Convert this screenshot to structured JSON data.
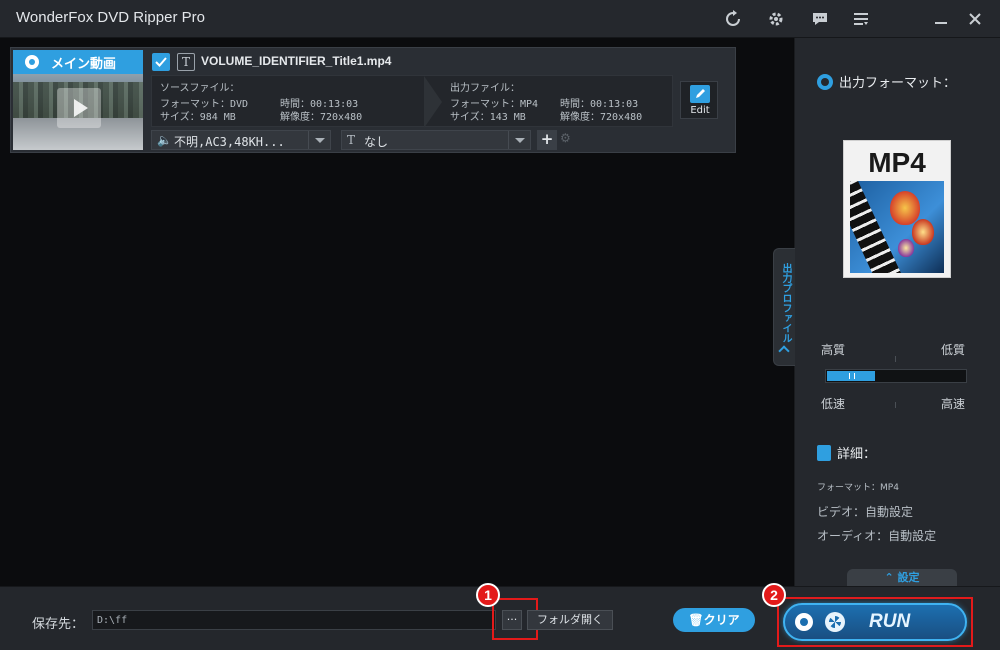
{
  "app": {
    "title": "WonderFox DVD Ripper Pro"
  },
  "titlebar_icons": [
    "refresh-icon",
    "settings-icon",
    "feedback-icon",
    "menu-icon",
    "minimize-icon",
    "close-icon"
  ],
  "item": {
    "thumb_label": "メイン動画",
    "checked": true,
    "file_name": "VOLUME_IDENTIFIER_Title1.mp4",
    "source": {
      "header": "ソースファイル：",
      "format": "フォーマット：DVD",
      "size": "サイズ：984 MB",
      "duration": "時間：00:13:03",
      "resolution": "解像度：720x480"
    },
    "output": {
      "header": "出力ファイル：",
      "format": "フォーマット：MP4",
      "size": "サイズ：143 MB",
      "duration": "時間：00:13:03",
      "resolution": "解像度：720x480"
    },
    "edit_label": "Edit",
    "audio_track": "不明,AC3,48KH...",
    "subtitle": "なし"
  },
  "right_panel": {
    "format_title": "出力フォーマット：",
    "format_name": "MP4",
    "profile_tab": "出力プロファイル",
    "quality": {
      "high": "高質",
      "low": "低質",
      "slow": "低速",
      "fast": "高速",
      "level": 0.35
    },
    "details_title": "詳細：",
    "detail_format": "フォーマット：MP4",
    "detail_video": "ビデオ：自動設定",
    "detail_audio": "オーディオ：自動設定",
    "settings_label": "設定"
  },
  "bottom": {
    "save_label": "保存先：",
    "path": "D:\\ff",
    "browse_label": "···",
    "open_folder": "フォルダ開く",
    "clear": "クリア",
    "run": "RUN",
    "badge1": "1",
    "badge2": "2"
  },
  "colors": {
    "accent": "#2f9fe0",
    "highlight": "#e31a1a",
    "background": "#0b0c0e",
    "panel": "#25282d"
  }
}
